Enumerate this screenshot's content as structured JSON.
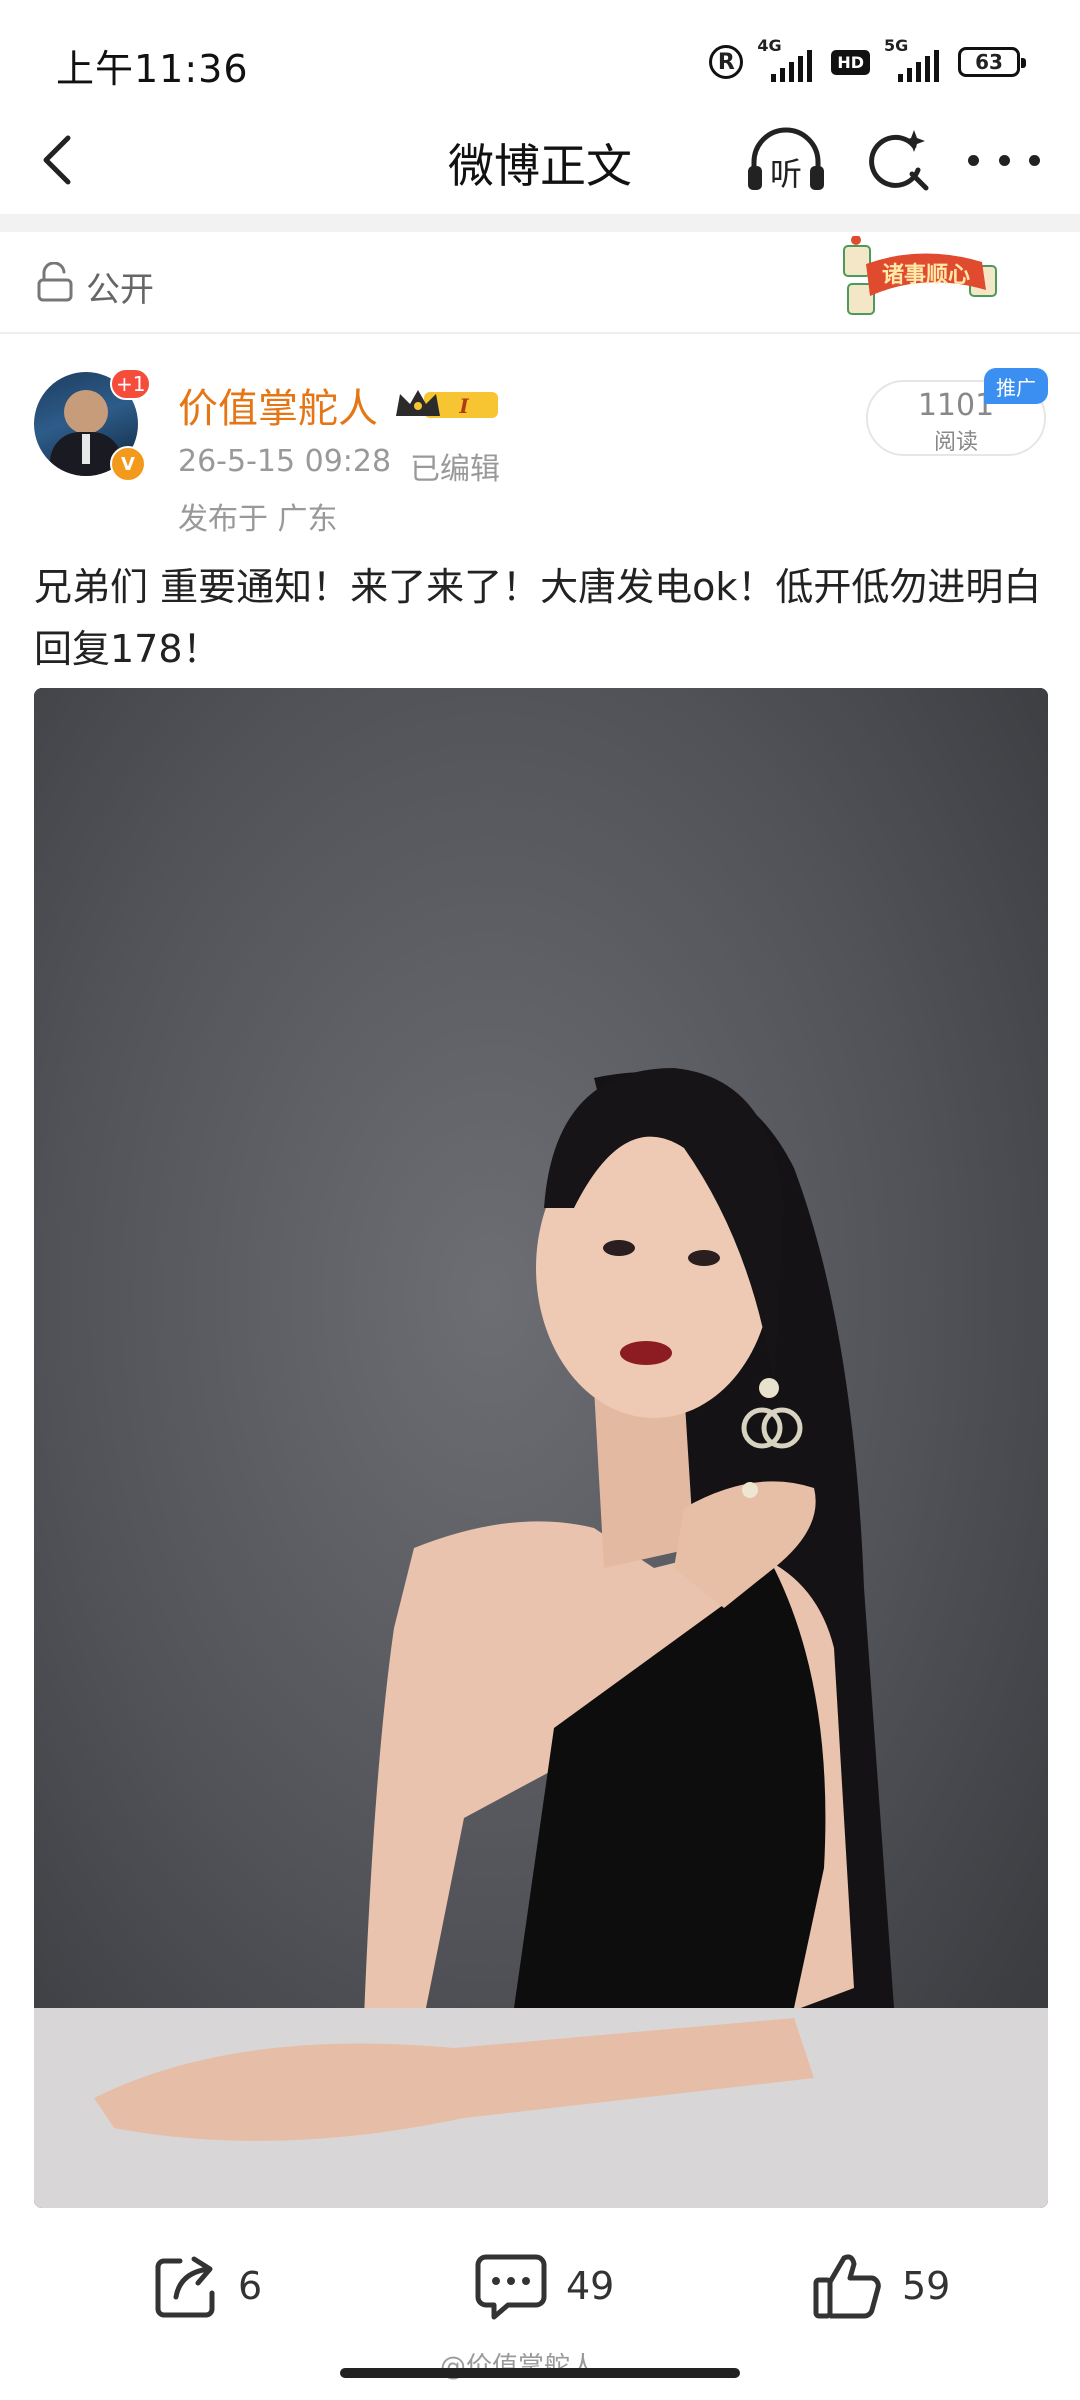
{
  "status_bar": {
    "time": "上午11:36",
    "r_icon": "R",
    "network_1": "4G",
    "hd": "HD",
    "network_2": "5G",
    "battery": "63"
  },
  "nav": {
    "title": "微博正文",
    "back_icon": "chevron-left-icon",
    "listen_label": "听",
    "search_icon": "ai-search-icon",
    "more_icon": "more-dots-icon"
  },
  "visibility": {
    "label": "公开",
    "banner_text": "诸事顺心"
  },
  "post": {
    "author": "价值掌舵人",
    "avatar_badge": "+1",
    "verified_badge": "V",
    "vip_level": "I",
    "time": "26-5-15 09:28",
    "edited": "已编辑",
    "location": "发布于 广东",
    "read_count": "1101",
    "read_label": "阅读",
    "promo_tag": "推广",
    "text": "兄弟们  重要通知！来了来了！大唐发电ok！低开低勿进明白回复178！"
  },
  "actions": {
    "repost_count": "6",
    "comment_count": "49",
    "like_count": "59"
  },
  "watermark": "@价值掌舵人",
  "colors": {
    "author_orange": "#e57616",
    "promo_blue": "#3b8ff0",
    "badge_red": "#f54c3b",
    "verified_orange": "#f39a1d"
  }
}
